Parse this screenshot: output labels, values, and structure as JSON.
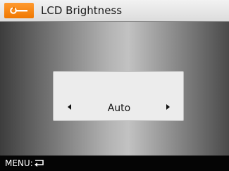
{
  "header": {
    "icon": "wrench-icon",
    "title": "LCD Brightness",
    "accent_color": "#f07800"
  },
  "setting": {
    "value": "Auto",
    "prev_icon": "left-arrow-icon",
    "next_icon": "right-arrow-icon"
  },
  "footer": {
    "menu_label": "MENU:",
    "back_icon": "return-icon"
  }
}
